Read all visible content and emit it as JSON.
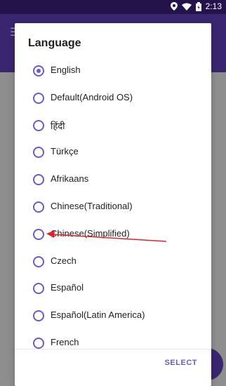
{
  "status_bar": {
    "time": "2:13",
    "icons": [
      "location-icon",
      "wifi-icon",
      "battery-icon"
    ]
  },
  "dialog": {
    "title": "Language",
    "options": [
      {
        "label": "English",
        "selected": true
      },
      {
        "label": "Default(Android OS)",
        "selected": false
      },
      {
        "label": "हिंदी",
        "selected": false
      },
      {
        "label": "Türkçe",
        "selected": false
      },
      {
        "label": "Afrikaans",
        "selected": false
      },
      {
        "label": "Chinese(Traditional)",
        "selected": false
      },
      {
        "label": "Chinese(Simplified)",
        "selected": false
      },
      {
        "label": "Czech",
        "selected": false
      },
      {
        "label": "Español",
        "selected": false
      },
      {
        "label": "Español(Latin America)",
        "selected": false
      },
      {
        "label": "French",
        "selected": false
      }
    ],
    "select_label": "SELECT"
  },
  "colors": {
    "accent": "#6e59c7",
    "app_bar": "#3a2670",
    "status_bar": "#24134a",
    "annotation": "#e0242b"
  }
}
